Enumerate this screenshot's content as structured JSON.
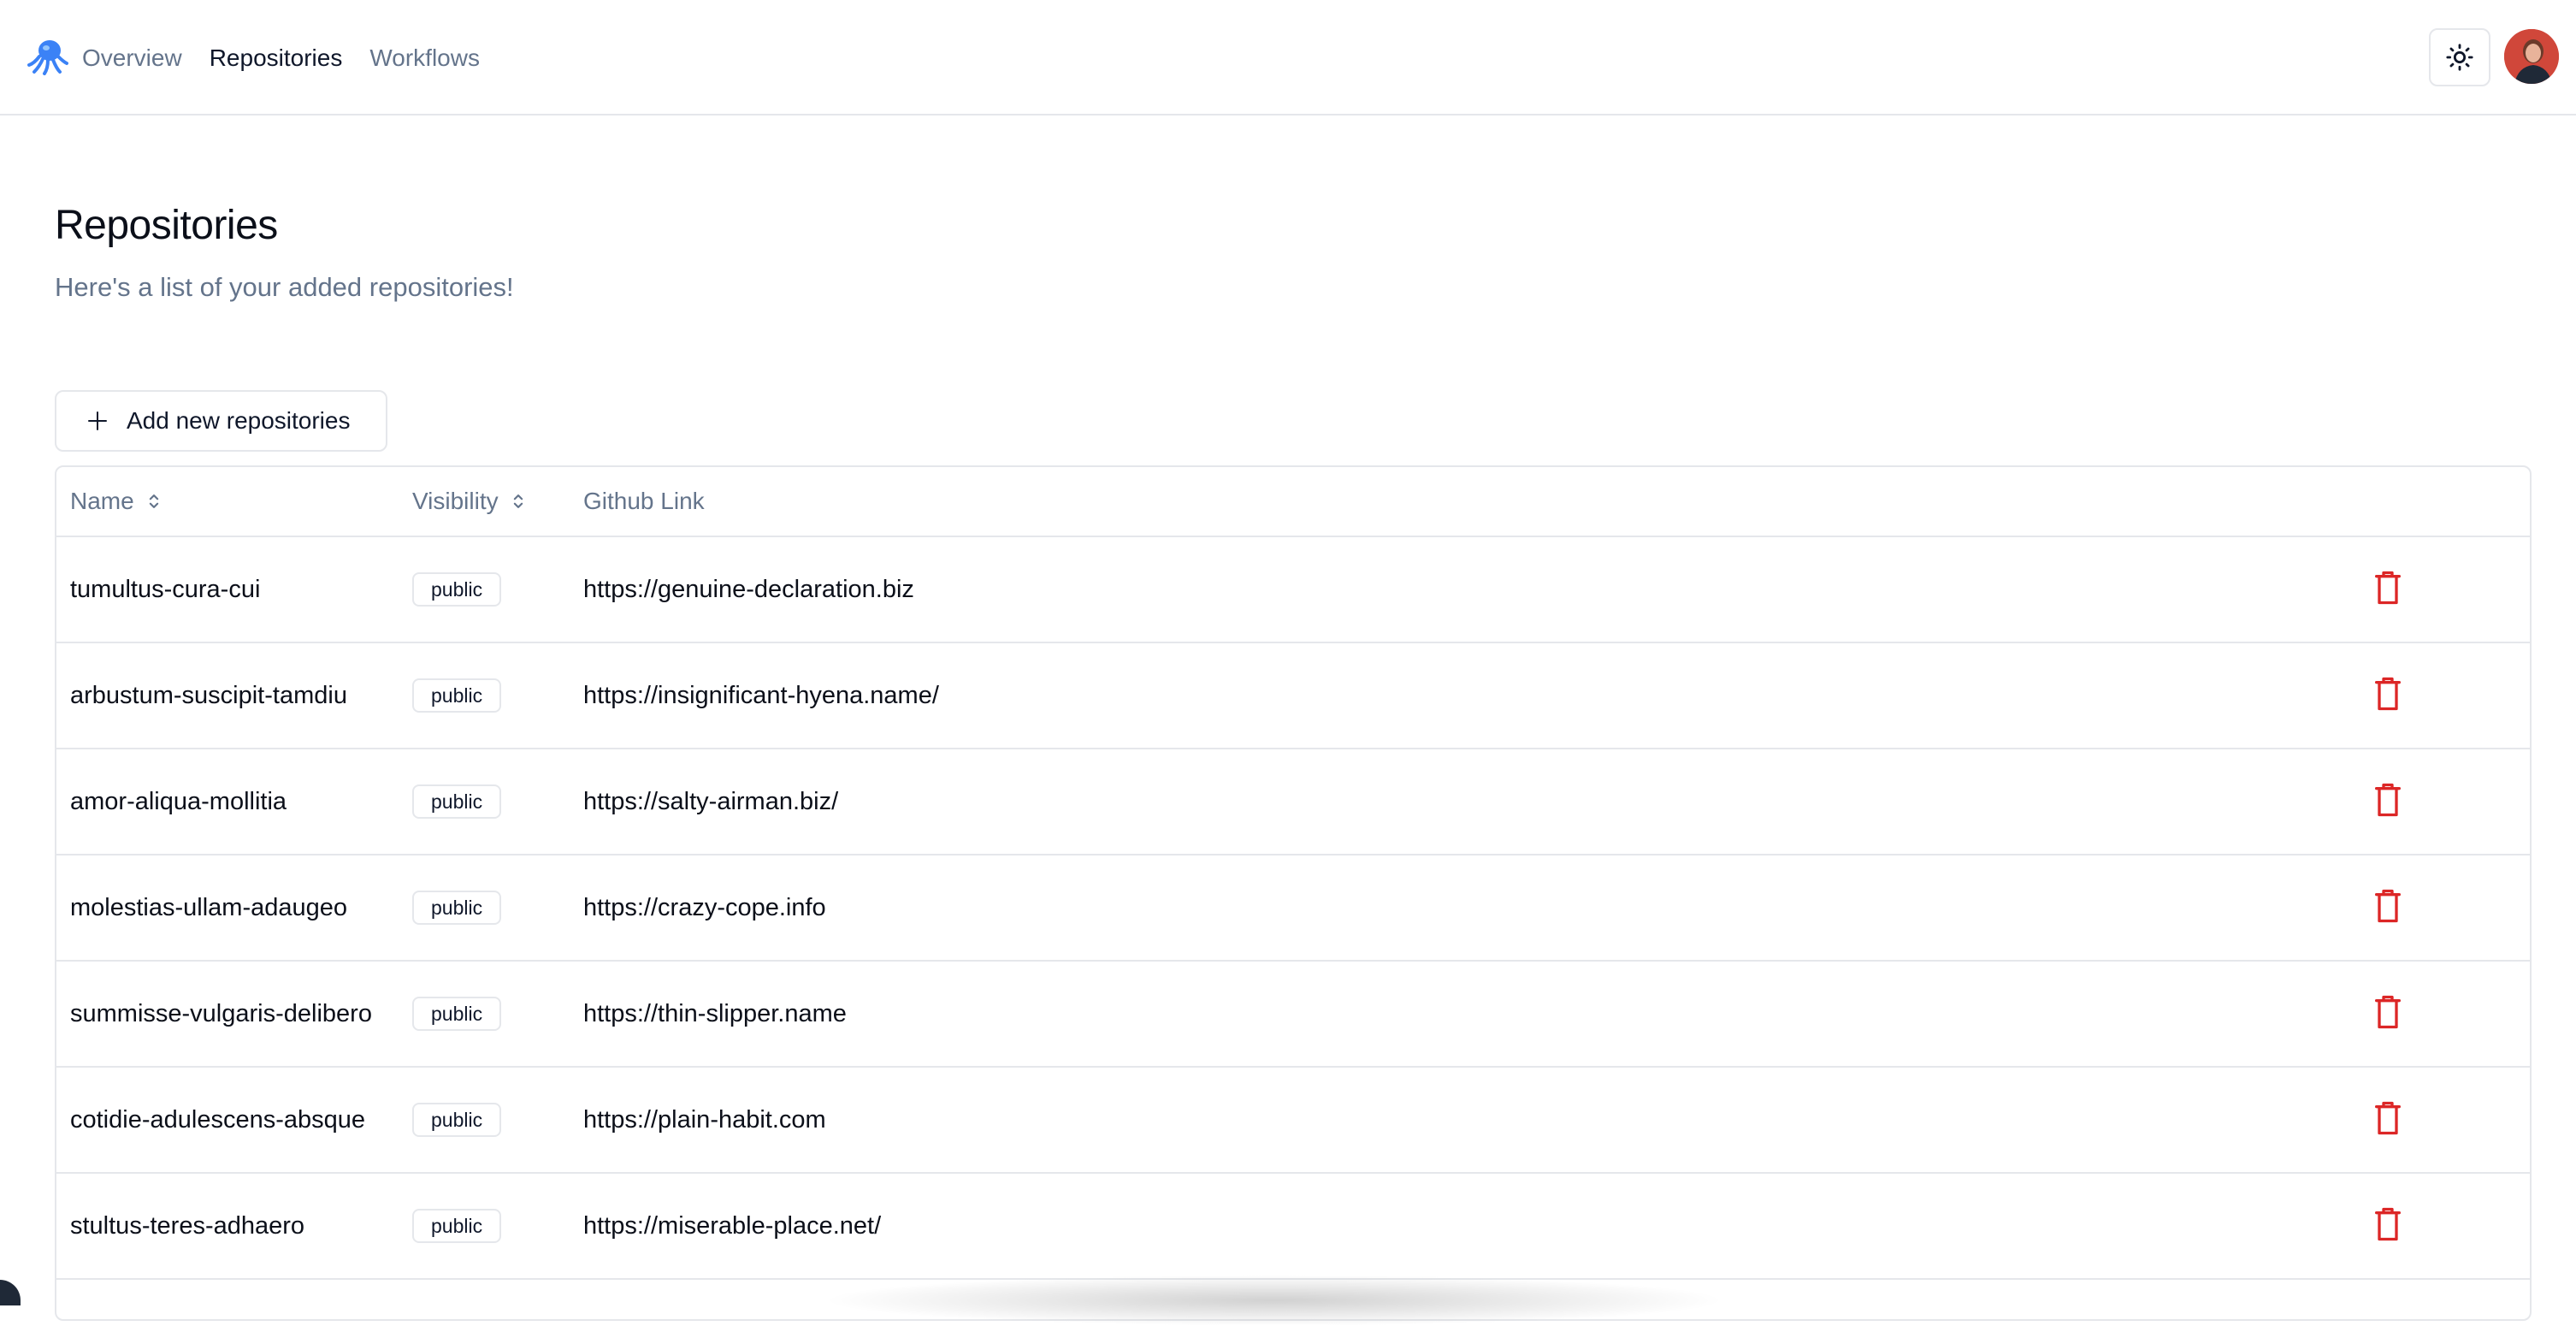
{
  "nav": {
    "logo_icon": "octopus-logo-icon",
    "links": [
      "Overview",
      "Repositories",
      "Workflows"
    ],
    "active": "Repositories"
  },
  "header_actions": {
    "theme_icon": "sun-icon",
    "avatar_icon": "user-avatar"
  },
  "page": {
    "title": "Repositories",
    "subtitle": "Here's a list of your added repositories!"
  },
  "add_button": {
    "label": "Add new repositories",
    "icon": "plus-icon"
  },
  "table": {
    "columns": [
      "Name",
      "Visibility",
      "Github Link"
    ],
    "rows": [
      {
        "name": "tumultus-cura-cui",
        "visibility": "public",
        "link": "https://genuine-declaration.biz"
      },
      {
        "name": "arbustum-suscipit-tamdiu",
        "visibility": "public",
        "link": "https://insignificant-hyena.name/"
      },
      {
        "name": "amor-aliqua-mollitia",
        "visibility": "public",
        "link": "https://salty-airman.biz/"
      },
      {
        "name": "molestias-ullam-adaugeo",
        "visibility": "public",
        "link": "https://crazy-cope.info"
      },
      {
        "name": "summisse-vulgaris-delibero",
        "visibility": "public",
        "link": "https://thin-slipper.name"
      },
      {
        "name": "cotidie-adulescens-absque",
        "visibility": "public",
        "link": "https://plain-habit.com"
      },
      {
        "name": "stultus-teres-adhaero",
        "visibility": "public",
        "link": "https://miserable-place.net/"
      }
    ],
    "delete_icon": "trash-icon"
  },
  "colors": {
    "danger": "#dc2626",
    "muted_text": "#64748b",
    "border": "#e5e7eb",
    "logo_blue": "#3b82f6"
  }
}
